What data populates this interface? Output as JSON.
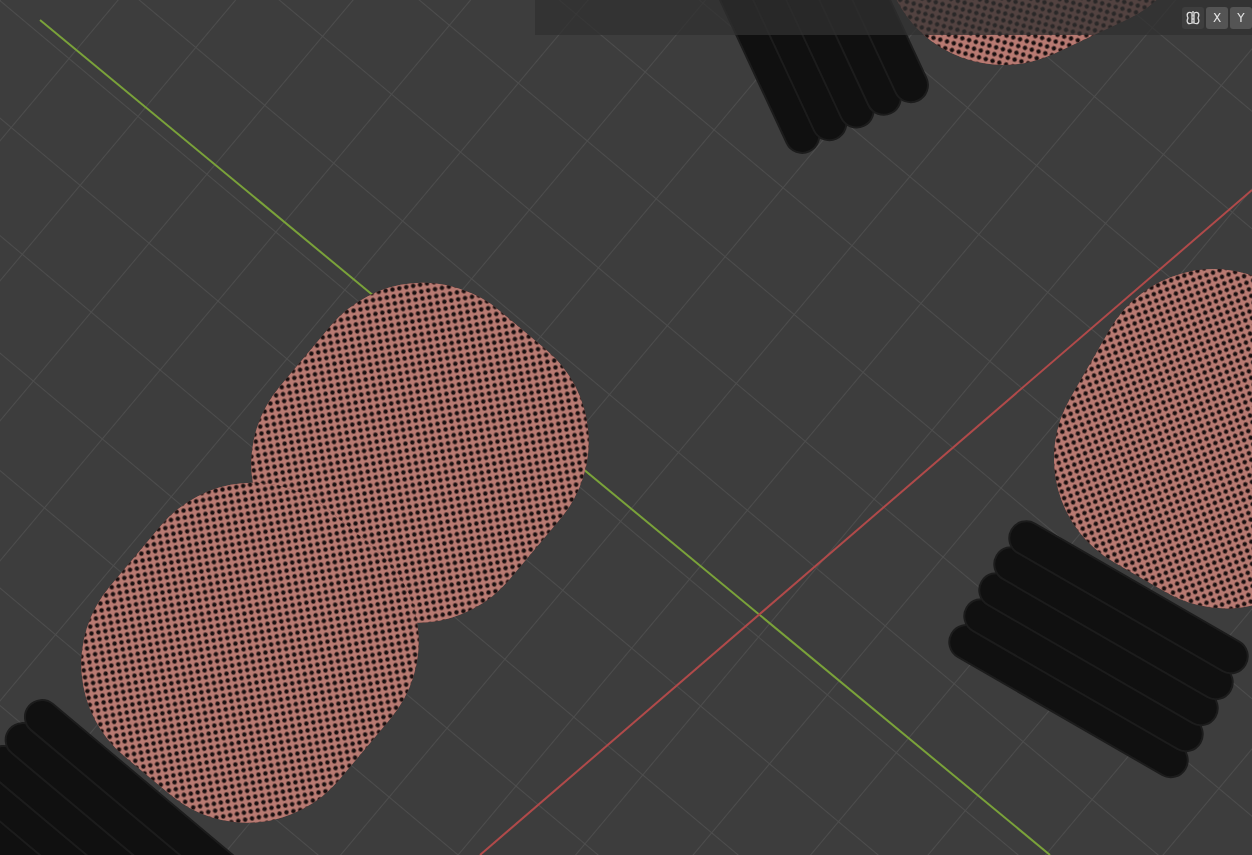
{
  "viewport": {
    "header": {
      "mirror_axes": [
        {
          "label": "X",
          "on": false
        },
        {
          "label": "Y",
          "on": false
        }
      ]
    }
  }
}
